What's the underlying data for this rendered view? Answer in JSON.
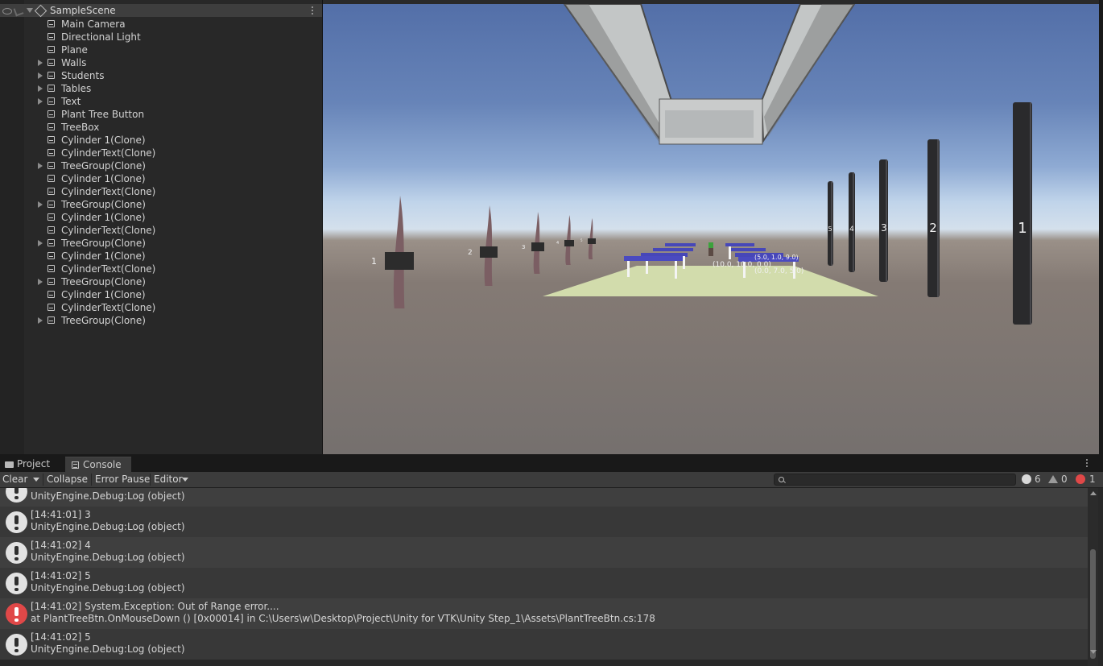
{
  "hierarchy": {
    "scene_name": "SampleScene",
    "items": [
      {
        "label": "Main Camera",
        "expandable": false
      },
      {
        "label": "Directional Light",
        "expandable": false
      },
      {
        "label": "Plane",
        "expandable": false
      },
      {
        "label": "Walls",
        "expandable": true
      },
      {
        "label": "Students",
        "expandable": true
      },
      {
        "label": "Tables",
        "expandable": true
      },
      {
        "label": "Text",
        "expandable": true
      },
      {
        "label": "Plant Tree Button",
        "expandable": false
      },
      {
        "label": "TreeBox",
        "expandable": false
      },
      {
        "label": "Cylinder 1(Clone)",
        "expandable": false
      },
      {
        "label": "CylinderText(Clone)",
        "expandable": false
      },
      {
        "label": "TreeGroup(Clone)",
        "expandable": true
      },
      {
        "label": "Cylinder 1(Clone)",
        "expandable": false
      },
      {
        "label": "CylinderText(Clone)",
        "expandable": false
      },
      {
        "label": "TreeGroup(Clone)",
        "expandable": true
      },
      {
        "label": "Cylinder 1(Clone)",
        "expandable": false
      },
      {
        "label": "CylinderText(Clone)",
        "expandable": false
      },
      {
        "label": "TreeGroup(Clone)",
        "expandable": true
      },
      {
        "label": "Cylinder 1(Clone)",
        "expandable": false
      },
      {
        "label": "CylinderText(Clone)",
        "expandable": false
      },
      {
        "label": "TreeGroup(Clone)",
        "expandable": true
      },
      {
        "label": "Cylinder 1(Clone)",
        "expandable": false
      },
      {
        "label": "CylinderText(Clone)",
        "expandable": false
      },
      {
        "label": "TreeGroup(Clone)",
        "expandable": true
      }
    ]
  },
  "scene": {
    "tree_labels": [
      "1",
      "2",
      "3",
      "4",
      "5"
    ],
    "pillar_labels": [
      "1",
      "2",
      "3",
      "4",
      "5"
    ],
    "coord_labels": [
      "(10.0, 10.0, 0.0)",
      "(5.0, 1.0, 9.0)",
      "(0.0, 7.0, 5.0)"
    ]
  },
  "tabs": {
    "project": "Project",
    "console": "Console"
  },
  "toolbar": {
    "clear": "Clear",
    "collapse": "Collapse",
    "error_pause": "Error Pause",
    "editor": "Editor",
    "log_count": "6",
    "warning_count": "0",
    "error_count": "1"
  },
  "colors": {
    "info_icon": "#e2e2e2",
    "error_icon": "#e04848",
    "warning_icon": "#9a9a9a"
  },
  "console": {
    "entries": [
      {
        "type": "info",
        "message": "",
        "detail": "UnityEngine.Debug:Log (object)"
      },
      {
        "type": "info",
        "message": "[14:41:01] 3",
        "detail": "UnityEngine.Debug:Log (object)"
      },
      {
        "type": "info",
        "message": "[14:41:02] 4",
        "detail": "UnityEngine.Debug:Log (object)"
      },
      {
        "type": "info",
        "message": "[14:41:02] 5",
        "detail": "UnityEngine.Debug:Log (object)"
      },
      {
        "type": "error",
        "message": "[14:41:02] System.Exception: Out of Range error....",
        "detail": " at PlantTreeBtn.OnMouseDown () [0x00014] in C:\\Users\\w\\Desktop\\Project\\Unity for VTK\\Unity Step_1\\Assets\\PlantTreeBtn.cs:178"
      },
      {
        "type": "info",
        "message": "[14:41:02] 5",
        "detail": "UnityEngine.Debug:Log (object)"
      }
    ]
  }
}
